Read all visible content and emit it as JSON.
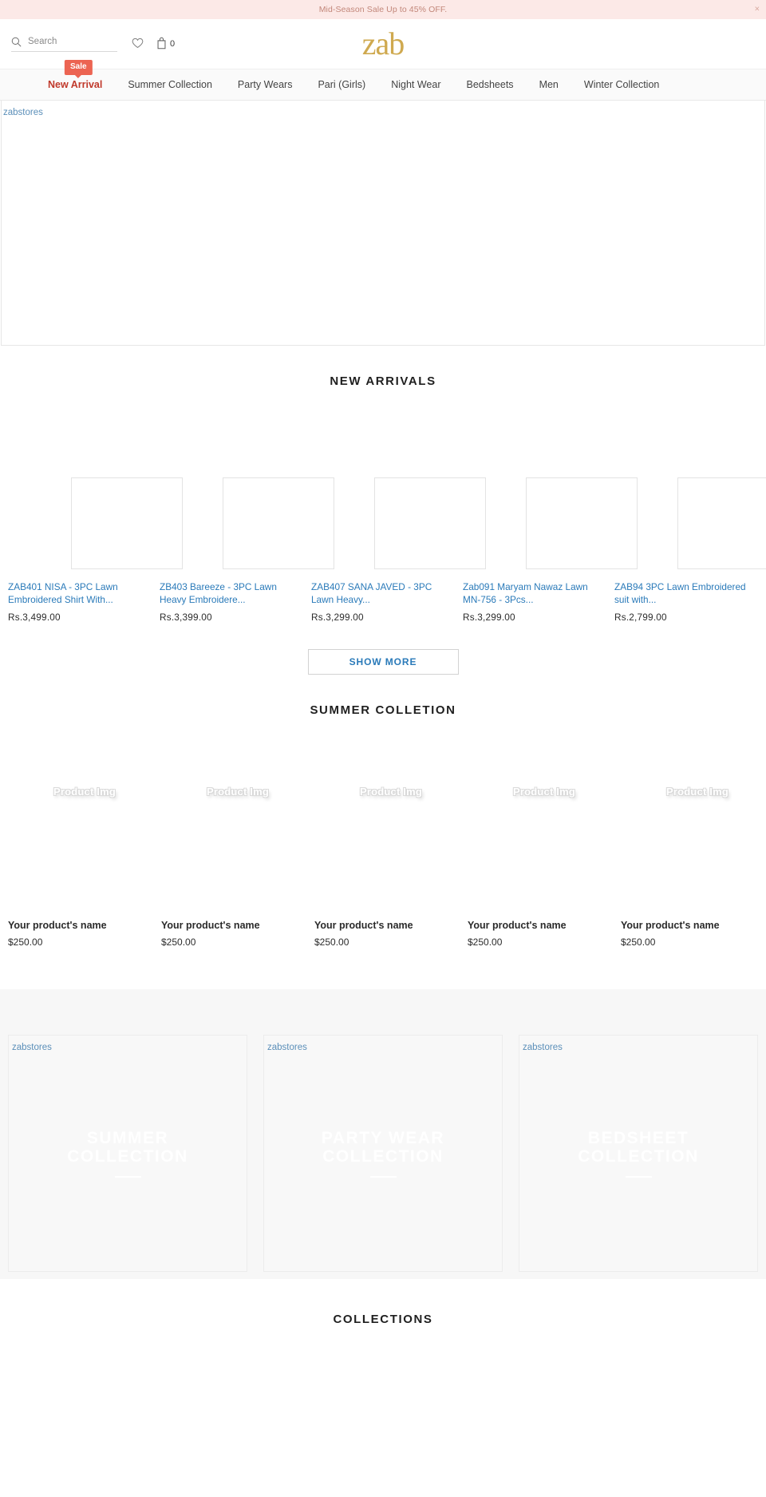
{
  "announcement": {
    "text": "Mid-Season Sale Up to 45% OFF.",
    "close_label": "×",
    "bg_color": "#fce9e7",
    "text_color": "#c2877a"
  },
  "header": {
    "search": {
      "placeholder": "Search",
      "value": "",
      "icon": "search-icon"
    },
    "wishlist": {
      "icon": "heart-icon"
    },
    "cart": {
      "icon": "bag-icon",
      "count": "0"
    },
    "logo": {
      "text": "zab",
      "color": "#cfa94f"
    }
  },
  "nav": {
    "items": [
      {
        "label": "New Arrival",
        "active": true,
        "badge": "Sale"
      },
      {
        "label": "Summer Collection",
        "active": false,
        "badge": ""
      },
      {
        "label": "Party Wears",
        "active": false,
        "badge": ""
      },
      {
        "label": "Pari (Girls)",
        "active": false,
        "badge": ""
      },
      {
        "label": "Night Wear",
        "active": false,
        "badge": ""
      },
      {
        "label": "Bedsheets",
        "active": false,
        "badge": ""
      },
      {
        "label": "Men",
        "active": false,
        "badge": ""
      },
      {
        "label": "Winter Collection",
        "active": false,
        "badge": ""
      }
    ],
    "active_color": "#c0392b",
    "badge_color": "#ec6452"
  },
  "hero": {
    "alt_text": "zabstores"
  },
  "new_arrivals": {
    "title": "NEW ARRIVALS",
    "products": [
      {
        "title": "ZAB401 NISA - 3PC Lawn Embroidered Shirt With...",
        "price": "Rs.3,499.00"
      },
      {
        "title": "ZB403 Bareeze - 3PC Lawn Heavy Embroidere...",
        "price": "Rs.3,399.00"
      },
      {
        "title": "ZAB407 SANA JAVED - 3PC Lawn Heavy...",
        "price": "Rs.3,299.00"
      },
      {
        "title": "Zab091 Maryam Nawaz Lawn MN-756 - 3Pcs...",
        "price": "Rs.3,299.00"
      },
      {
        "title": "ZAB94 3PC Lawn Embroidered suit with...",
        "price": "Rs.2,799.00"
      }
    ],
    "show_more_label": "SHOW MORE"
  },
  "summer_collection": {
    "title": "SUMMER COLLETION",
    "products": [
      {
        "placeholder": "Product Img",
        "name": "Your product's name",
        "price": "$250.00"
      },
      {
        "placeholder": "Product Img",
        "name": "Your product's name",
        "price": "$250.00"
      },
      {
        "placeholder": "Product Img",
        "name": "Your product's name",
        "price": "$250.00"
      },
      {
        "placeholder": "Product Img",
        "name": "Your product's name",
        "price": "$250.00"
      },
      {
        "placeholder": "Product Img",
        "name": "Your product's name",
        "price": "$250.00"
      }
    ]
  },
  "collection_banners": [
    {
      "alt_text": "zabstores",
      "line1": "SUMMER",
      "line2": "COLLECTION"
    },
    {
      "alt_text": "zabstores",
      "line1": "PARTY WEAR",
      "line2": "COLLECTION"
    },
    {
      "alt_text": "zabstores",
      "line1": "BEDSHEET",
      "line2": "COLLECTION"
    }
  ],
  "footer_section": {
    "title": "COLLECTIONS"
  }
}
